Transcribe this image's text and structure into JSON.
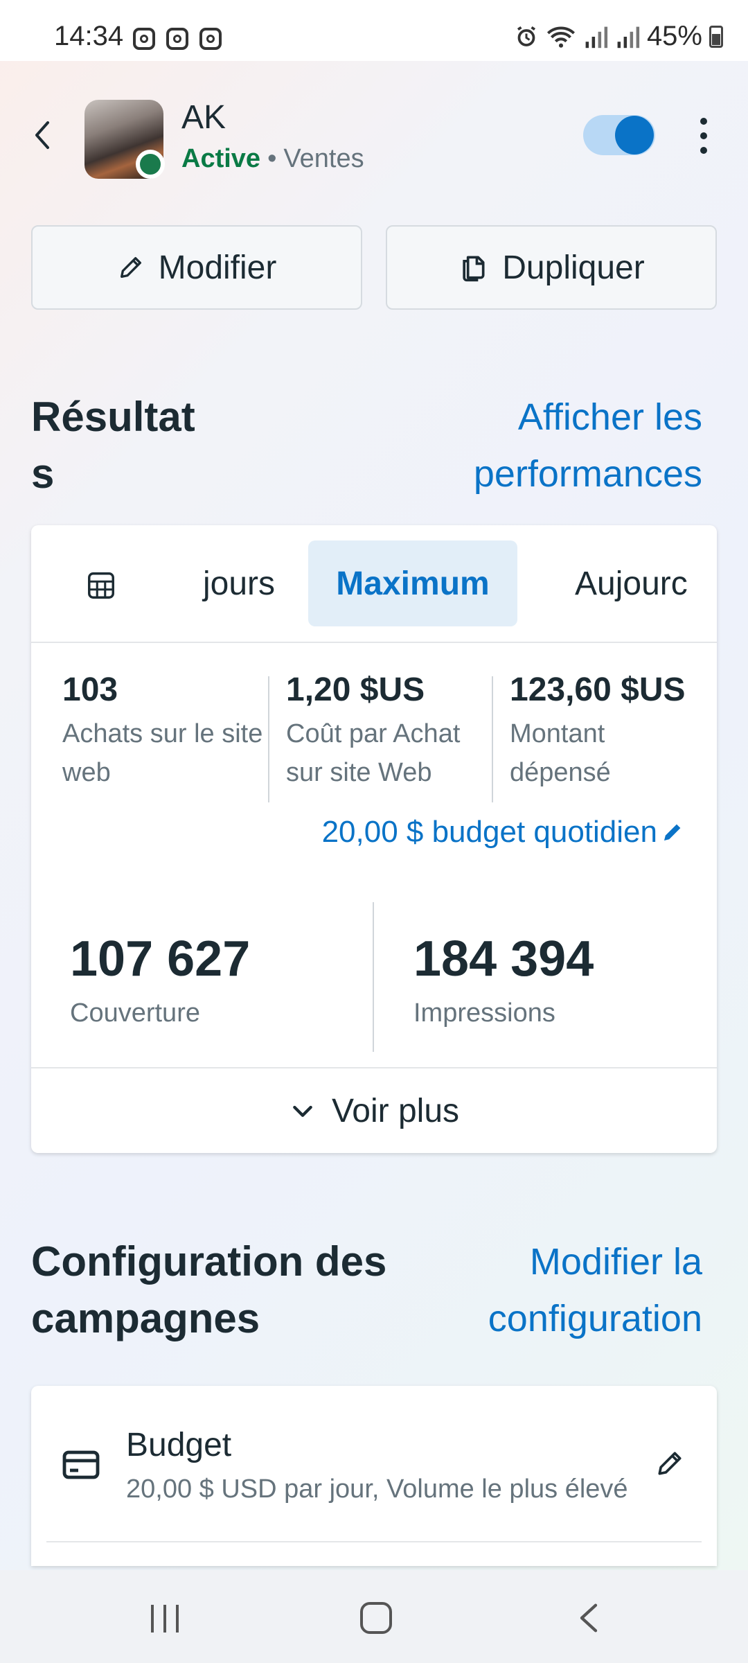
{
  "status_bar": {
    "time": "14:34",
    "battery": "45%",
    "notification_icons": [
      "instagram-icon",
      "instagram-icon",
      "instagram-icon"
    ],
    "system_icons": [
      "alarm-icon",
      "wifi-icon",
      "signal-icon",
      "signal-icon",
      "battery-icon"
    ]
  },
  "header": {
    "campaign_name": "AK",
    "status": "Active",
    "separator": "•",
    "objective": "Ventes",
    "toggle_on": true,
    "status_color": "#0a7a45"
  },
  "actions": {
    "edit_label": "Modifier",
    "duplicate_label": "Dupliquer"
  },
  "results": {
    "title_line1": "Résultat",
    "title_line2": "s",
    "link_line1": "Afficher les",
    "link_line2": "performances",
    "tabs": [
      {
        "label": "jours",
        "selected": false
      },
      {
        "label": "Maximum",
        "selected": true
      },
      {
        "label": "Aujourc",
        "selected": false
      }
    ],
    "metrics": [
      {
        "value": "103",
        "label_line1": "Achats sur le site",
        "label_line2": "web"
      },
      {
        "value": "1,20 $US",
        "label_line1": "Coût par Achat",
        "label_line2": "sur site Web"
      },
      {
        "value": "123,60 $US",
        "label_line1": "Montant",
        "label_line2": "dépensé"
      }
    ],
    "budget_link": "20,00 $ budget quotidien",
    "reach": {
      "value": "107 627",
      "label": "Couverture"
    },
    "impressions": {
      "value": "184 394",
      "label": "Impressions"
    },
    "see_more": "Voir plus"
  },
  "config": {
    "title_line1": "Configuration des",
    "title_line2": "campagnes",
    "link_line1": "Modifier la",
    "link_line2": "configuration",
    "budget": {
      "title": "Budget",
      "description": "20,00 $ USD par jour, Volume le plus élevé"
    }
  },
  "colors": {
    "accent": "#0a73c7",
    "text": "#1c2b33",
    "secondary_text": "#65737c"
  }
}
